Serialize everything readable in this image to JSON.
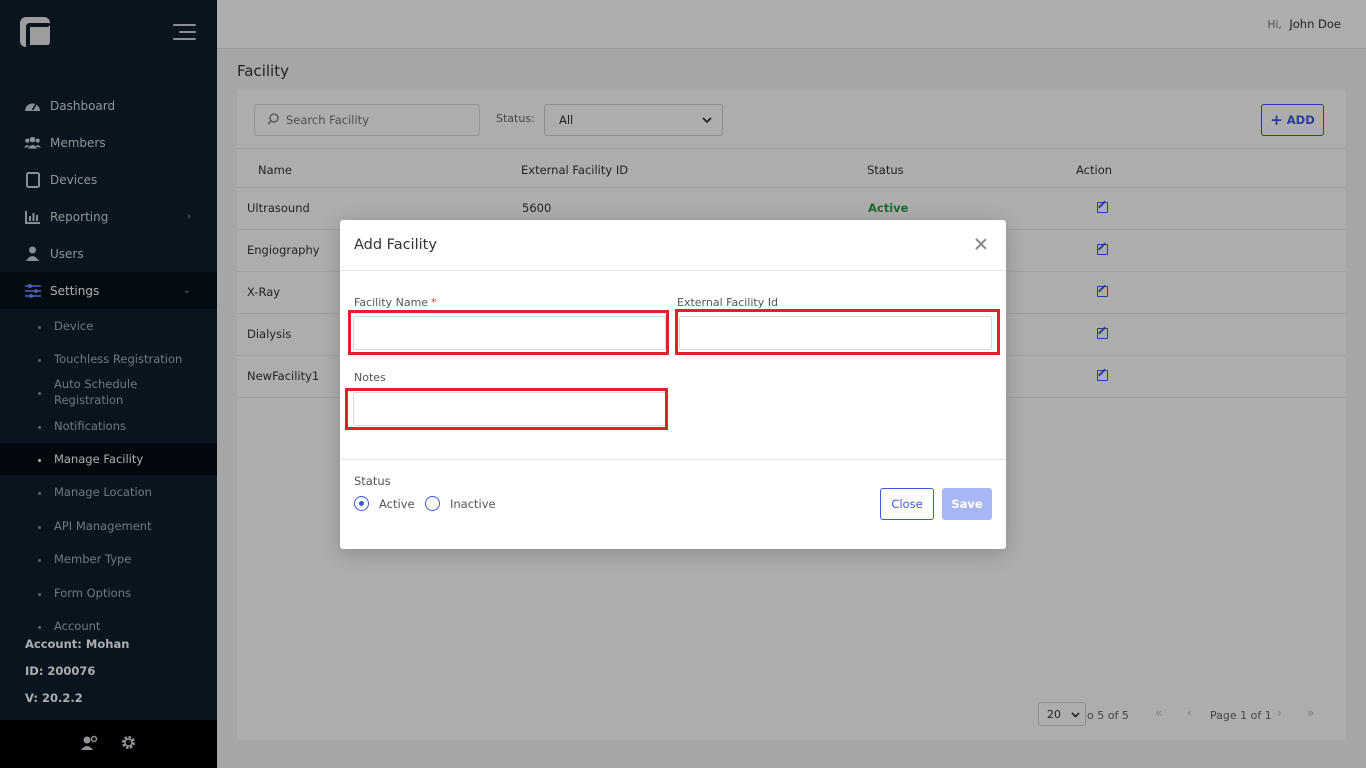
{
  "topbar": {
    "hi": "Hi,",
    "user": "John Doe"
  },
  "sidebar": {
    "items": [
      {
        "label": "Dashboard",
        "icon": "dashboard-icon"
      },
      {
        "label": "Members",
        "icon": "members-icon"
      },
      {
        "label": "Devices",
        "icon": "devices-icon"
      },
      {
        "label": "Reporting",
        "icon": "reporting-icon",
        "chevron": "›"
      },
      {
        "label": "Users",
        "icon": "users-icon"
      },
      {
        "label": "Settings",
        "icon": "settings-icon",
        "chevron": "⌄"
      }
    ],
    "sub_items": [
      "Device",
      "Touchless Registration",
      "Auto Schedule Registration",
      "Notifications",
      "Manage Facility",
      "Manage Location",
      "API Management",
      "Member Type",
      "Form Options",
      "Account"
    ],
    "account": "Account: Mohan",
    "id": "ID: 200076",
    "version": "V: 20.2.2"
  },
  "page": {
    "title": "Facility"
  },
  "toolbar": {
    "search_placeholder": "Search Facility",
    "status_label": "Status:",
    "status_value": "All",
    "add_label": "ADD"
  },
  "table": {
    "headers": [
      "Name",
      "External Facility ID",
      "Status",
      "Action"
    ],
    "rows": [
      {
        "name": "Ultrasound",
        "ext_id": "5600",
        "status": "Active"
      },
      {
        "name": "Engiography",
        "ext_id": "",
        "status": ""
      },
      {
        "name": "X-Ray",
        "ext_id": "",
        "status": ""
      },
      {
        "name": "Dialysis",
        "ext_id": "",
        "status": ""
      },
      {
        "name": "NewFacility1",
        "ext_id": "",
        "status": ""
      }
    ]
  },
  "pager": {
    "page_size": "20",
    "range": "o 5 of 5",
    "page": "Page 1 of 1"
  },
  "modal": {
    "title": "Add Facility",
    "facility_name_label": "Facility Name",
    "required_mark": "*",
    "external_id_label": "External Facility Id",
    "notes_label": "Notes",
    "status_label": "Status",
    "active_label": "Active",
    "inactive_label": "Inactive",
    "close_label": "Close",
    "save_label": "Save"
  },
  "colors": {
    "accent": "#3b5bdb",
    "sidebar": "#0e1e2e",
    "highlight": "#e0202a",
    "active_status": "#2e9b48"
  }
}
